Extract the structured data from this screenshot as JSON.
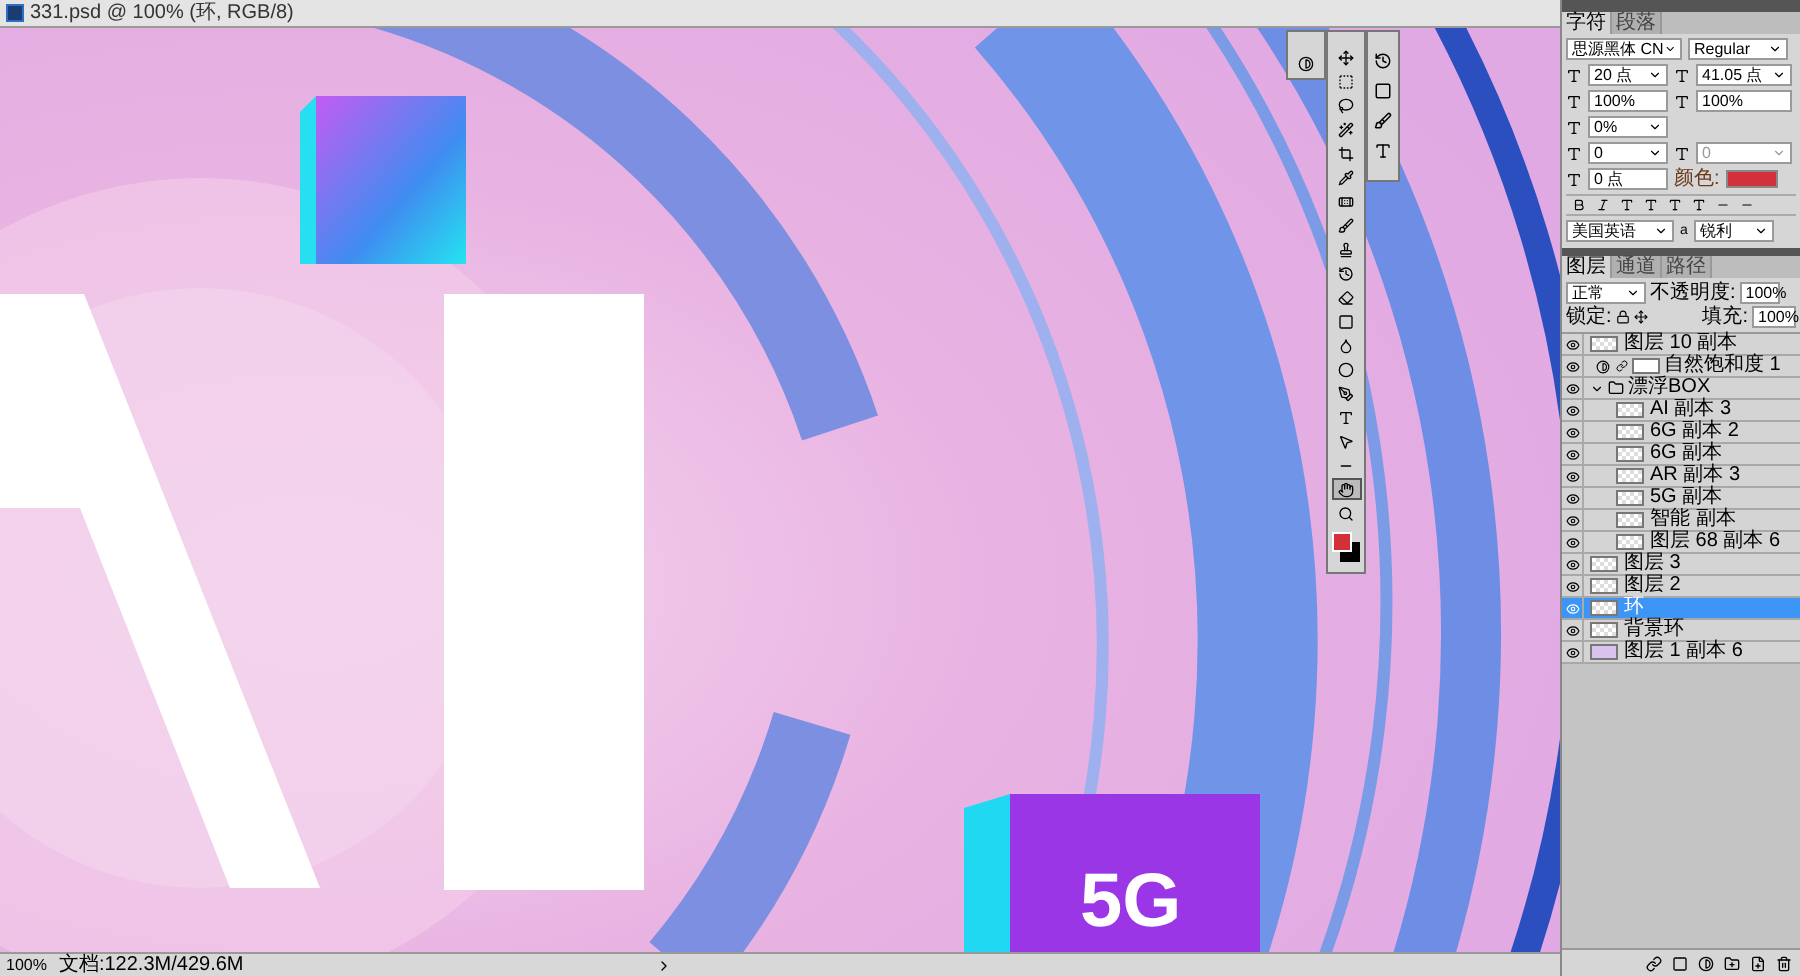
{
  "window": {
    "title": "331.psd @ 100% (环, RGB/8)"
  },
  "canvas": {
    "cube_label": "5G"
  },
  "tools": [
    {
      "kind": "move",
      "selected": false
    },
    {
      "kind": "marquee",
      "selected": false
    },
    {
      "kind": "lasso",
      "selected": false
    },
    {
      "kind": "wand",
      "selected": false
    },
    {
      "kind": "crop",
      "selected": false
    },
    {
      "kind": "eyedropper",
      "selected": false
    },
    {
      "kind": "heal",
      "selected": false
    },
    {
      "kind": "brush",
      "selected": false
    },
    {
      "kind": "stamp",
      "selected": false
    },
    {
      "kind": "history",
      "selected": false
    },
    {
      "kind": "eraser",
      "selected": false
    },
    {
      "kind": "gradient",
      "selected": false
    },
    {
      "kind": "blur",
      "selected": false
    },
    {
      "kind": "dodge",
      "selected": false
    },
    {
      "kind": "pen",
      "selected": false
    },
    {
      "kind": "type",
      "selected": false
    },
    {
      "kind": "select",
      "selected": false
    },
    {
      "kind": "line",
      "selected": false
    },
    {
      "kind": "hand",
      "selected": true
    },
    {
      "kind": "zoom",
      "selected": false
    }
  ],
  "character_panel": {
    "tabs": [
      {
        "label": "字符",
        "selected": true
      },
      {
        "label": "段落",
        "selected": false
      }
    ],
    "font_family": "思源黑体 CN",
    "font_style": "Regular",
    "size": "20 点",
    "leading": "41.05 点",
    "vertical_scale": "100%",
    "horizontal_scale": "100%",
    "tsume": "0%",
    "tracking": "0",
    "kerning": "0",
    "baseline_shift": "0 点",
    "color_label": "颜色:",
    "language": "美国英语",
    "antialias_icon": "a",
    "antialias": "锐利"
  },
  "layers_panel": {
    "tabs": [
      {
        "label": "图层",
        "selected": true
      },
      {
        "label": "通道",
        "selected": false
      },
      {
        "label": "路径",
        "selected": false
      }
    ],
    "blend_mode": "正常",
    "opacity_label": "不透明度:",
    "opacity": "100%",
    "lock_label": "锁定:",
    "fill_label": "填充:",
    "fill": "100%",
    "layers": [
      {
        "kind": "layer",
        "name": "图层 10 副本",
        "visible": true,
        "selected": false
      },
      {
        "kind": "adjustment",
        "name": "自然饱和度 1",
        "visible": true,
        "selected": false
      },
      {
        "kind": "group",
        "name": "漂浮BOX",
        "visible": true,
        "selected": false,
        "expanded": true,
        "children": [
          {
            "kind": "layer",
            "name": "AI 副本 3",
            "visible": true,
            "selected": false
          },
          {
            "kind": "layer",
            "name": "6G 副本 2",
            "visible": true,
            "selected": false
          },
          {
            "kind": "layer",
            "name": "6G 副本",
            "visible": true,
            "selected": false
          },
          {
            "kind": "layer",
            "name": "AR 副本 3",
            "visible": true,
            "selected": false
          },
          {
            "kind": "layer",
            "name": "5G 副本",
            "visible": true,
            "selected": false
          },
          {
            "kind": "layer",
            "name": "智能 副本",
            "visible": true,
            "selected": false
          },
          {
            "kind": "layer",
            "name": "图层 68 副本 6",
            "visible": true,
            "selected": false
          }
        ]
      },
      {
        "kind": "layer",
        "name": "图层 3",
        "visible": true,
        "selected": false
      },
      {
        "kind": "layer",
        "name": "图层 2",
        "visible": true,
        "selected": false
      },
      {
        "kind": "layer",
        "name": "环",
        "visible": true,
        "selected": true
      },
      {
        "kind": "layer",
        "name": "背景环",
        "visible": true,
        "selected": false
      },
      {
        "kind": "fill",
        "name": "图层 1 副本 6",
        "visible": true,
        "selected": false
      }
    ]
  },
  "status_bar": {
    "zoom": "100%",
    "document": "文档:122.3M/429.6M"
  }
}
